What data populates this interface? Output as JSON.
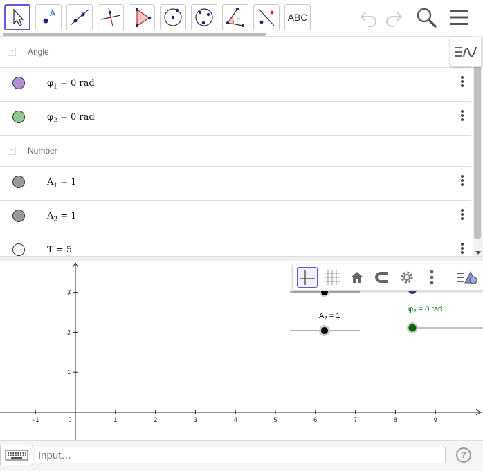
{
  "toolbar": {
    "tools": [
      {
        "name": "move-tool"
      },
      {
        "name": "point-tool",
        "text": "A"
      },
      {
        "name": "line-tool"
      },
      {
        "name": "perpendicular-line-tool"
      },
      {
        "name": "polygon-tool"
      },
      {
        "name": "circle-center-point-tool"
      },
      {
        "name": "circle-three-points-tool"
      },
      {
        "name": "angle-tool",
        "text": "α"
      },
      {
        "name": "reflect-tool"
      },
      {
        "name": "text-tool",
        "text": "ABC"
      }
    ],
    "accent_color": "#6557d2"
  },
  "algebra": {
    "groups": [
      {
        "label": "Angle"
      },
      {
        "label": "Number"
      }
    ],
    "rows": [
      {
        "symbol": "φ",
        "sub": "1",
        "rest": " = 0 rad",
        "color": "#b48fd6"
      },
      {
        "symbol": "φ",
        "sub": "2",
        "rest": " = 0 rad",
        "color": "#8fc98f"
      },
      {
        "symbol": "A",
        "sub": "1",
        "rest": " = 1",
        "color": "#999999"
      },
      {
        "symbol": "A",
        "sub": "2",
        "rest": " = 1",
        "color": "#999999"
      },
      {
        "symbol": "T",
        "sub": "",
        "rest": " = 5",
        "color": "#ffffff"
      }
    ]
  },
  "graphics": {
    "x_ticks": [
      "−1",
      "0",
      "1",
      "2",
      "3",
      "4",
      "5",
      "6",
      "7",
      "8",
      "9"
    ],
    "y_ticks": [
      "1",
      "2",
      "3"
    ],
    "slider_a2_label": "A",
    "slider_a2_sub": "2",
    "slider_a2_rest": " = 1",
    "slider_phi2_label": "φ",
    "slider_phi2_sub": "2",
    "slider_phi2_rest": " = 0 rad",
    "phi2_color": "#006400"
  },
  "input_bar": {
    "placeholder": "Input…",
    "help": "?"
  }
}
